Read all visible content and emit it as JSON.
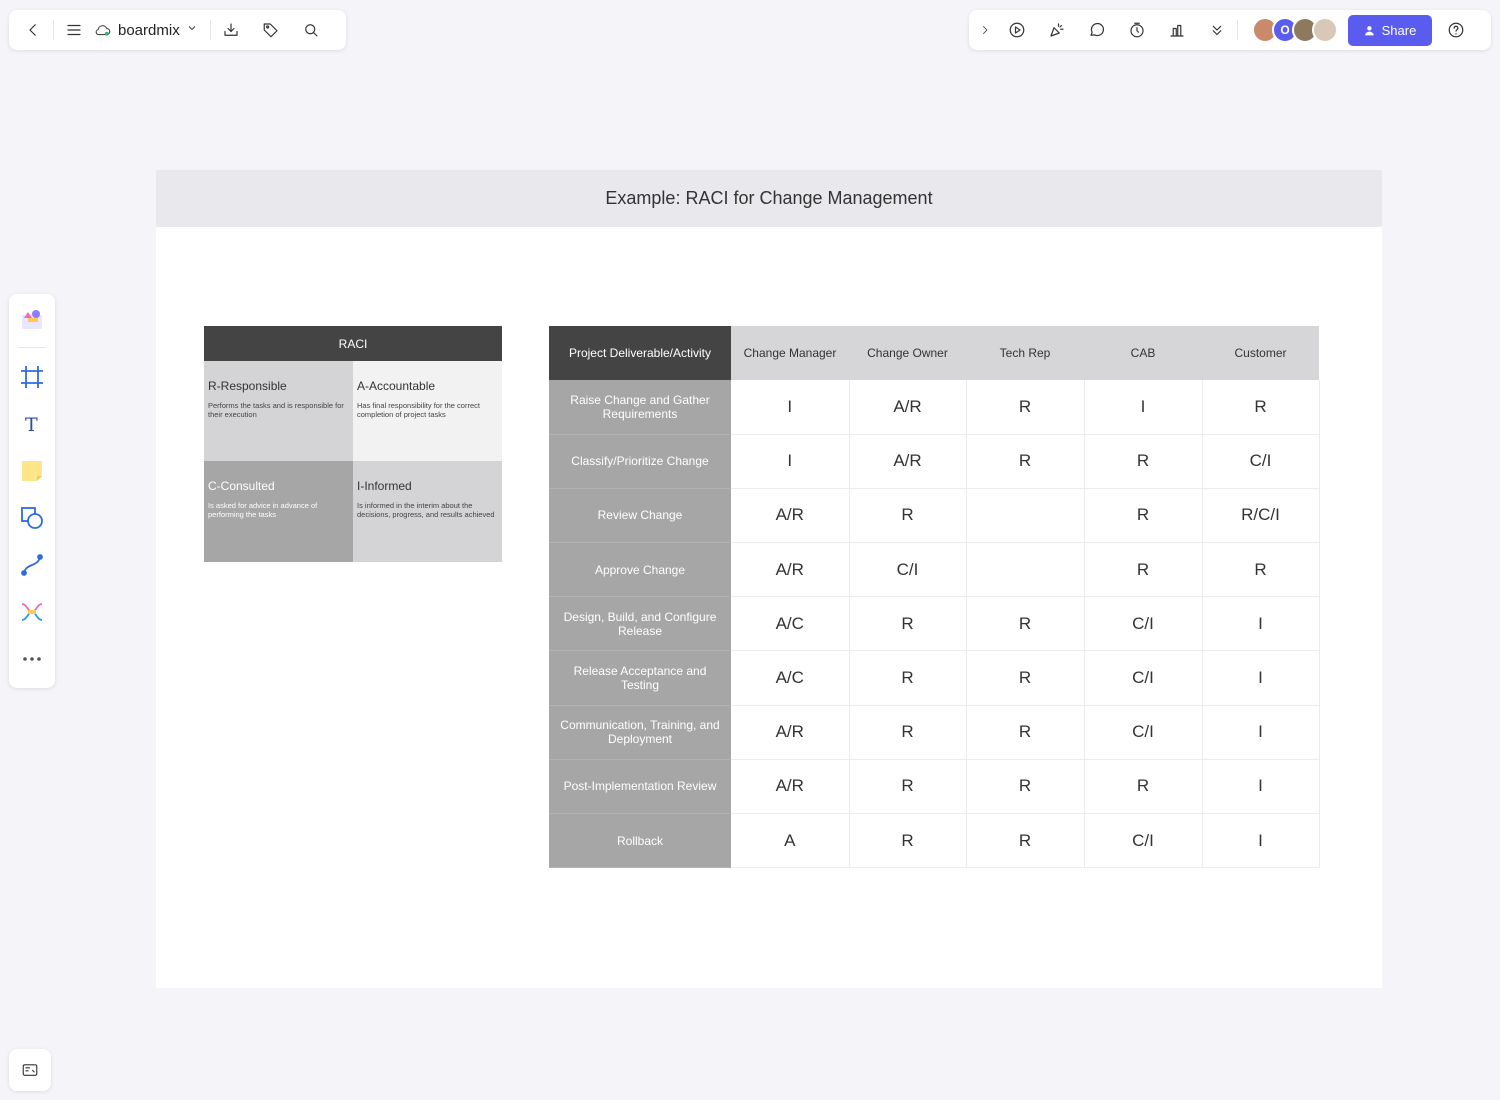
{
  "app": {
    "brand": "boardmix",
    "share_label": "Share",
    "avatar_initial": "O"
  },
  "toolbar_left_icons": [
    "back-icon",
    "menu-icon",
    "cloud-icon",
    "chevron-down-icon",
    "download-icon",
    "tag-icon",
    "search-icon"
  ],
  "toolbar_right_icons": [
    "chevron-right-icon",
    "play-icon",
    "celebrate-icon",
    "comment-icon",
    "timer-icon",
    "vote-icon",
    "more-down-icon",
    "help-icon"
  ],
  "left_rail_icons": [
    "templates-icon",
    "frame-icon",
    "text-icon",
    "sticky-note-icon",
    "shape-icon",
    "connector-icon",
    "mindmap-icon",
    "more-icon"
  ],
  "colors": {
    "accent": "#5a5cf0",
    "header_dark": "#444444",
    "cell_gray": "#a6a6a6",
    "cell_light": "#d4d4d6"
  },
  "frame": {
    "title": "Example: RACI for Change Management"
  },
  "raci_legend": {
    "title": "RACI",
    "cells": [
      {
        "title": "R-Responsible",
        "desc": "Performs the tasks and is responsible for their execution"
      },
      {
        "title": "A-Accountable",
        "desc": "Has final responsibility for the correct completion of project tasks"
      },
      {
        "title": "C-Consulted",
        "desc": "Is asked for advice in advance of performing the tasks"
      },
      {
        "title": "I-Informed",
        "desc": "Is informed in the interim about the decisions, progress, and results achieved"
      }
    ]
  },
  "matrix": {
    "headers": [
      "Project Deliverable/Activity",
      "Change Manager",
      "Change Owner",
      "Tech Rep",
      "CAB",
      "Customer"
    ],
    "rows": [
      {
        "activity": "Raise Change and Gather Requirements",
        "values": [
          "I",
          "A/R",
          "R",
          "I",
          "R"
        ]
      },
      {
        "activity": "Classify/Prioritize Change",
        "values": [
          "I",
          "A/R",
          "R",
          "R",
          "C/I"
        ]
      },
      {
        "activity": "Review Change",
        "values": [
          "A/R",
          "R",
          "",
          "R",
          "R/C/I"
        ]
      },
      {
        "activity": "Approve Change",
        "values": [
          "A/R",
          "C/I",
          "",
          "R",
          "R"
        ]
      },
      {
        "activity": "Design, Build, and Configure Release",
        "values": [
          "A/C",
          "R",
          "R",
          "C/I",
          "I"
        ]
      },
      {
        "activity": "Release Acceptance and Testing",
        "values": [
          "A/C",
          "R",
          "R",
          "C/I",
          "I"
        ]
      },
      {
        "activity": "Communication, Training, and Deployment",
        "values": [
          "A/R",
          "R",
          "R",
          "C/I",
          "I"
        ]
      },
      {
        "activity": "Post-Implementation Review",
        "values": [
          "A/R",
          "R",
          "R",
          "R",
          "I"
        ]
      },
      {
        "activity": "Rollback",
        "values": [
          "A",
          "R",
          "R",
          "C/I",
          "I"
        ]
      }
    ]
  }
}
